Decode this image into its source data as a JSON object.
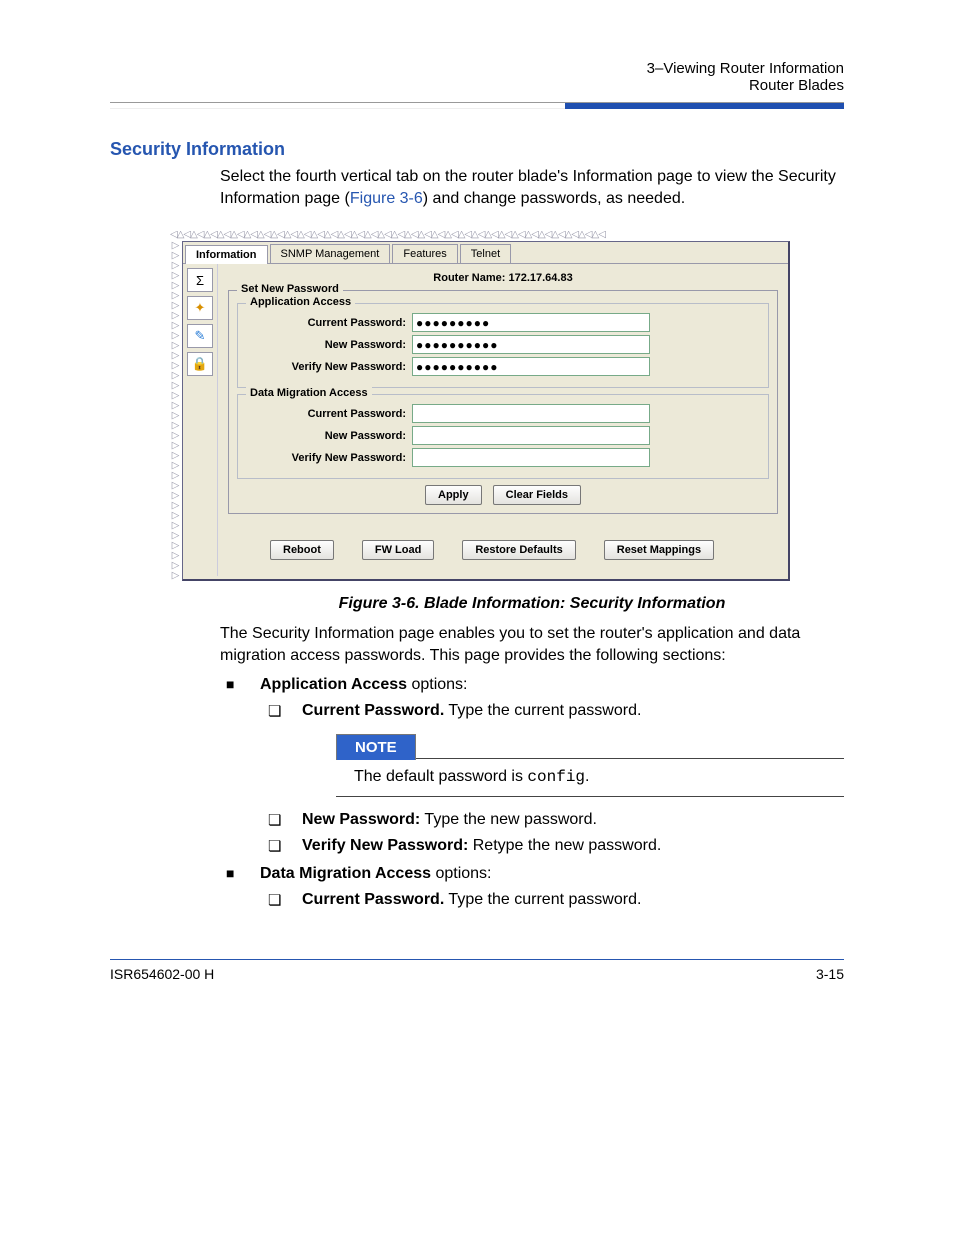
{
  "header": {
    "line1": "3–Viewing Router Information",
    "line2": "Router Blades"
  },
  "section_title": "Security Information",
  "intro_before_link": "Select the fourth vertical tab on the router blade's Information page to view the Security Information page (",
  "intro_link": "Figure 3-6",
  "intro_after_link": ") and change passwords, as needed.",
  "screenshot": {
    "tabs": [
      "Information",
      "SNMP Management",
      "Features",
      "Telnet"
    ],
    "active_tab_index": 0,
    "side_icons": [
      "Σ",
      "✦",
      "✎",
      "🔒"
    ],
    "router_label": "Router Name:",
    "router_name": "172.17.64.83",
    "set_new_password": "Set New Password",
    "app_access": {
      "legend": "Application Access",
      "current_label": "Current Password:",
      "current_value": "●●●●●●●●●",
      "new_label": "New Password:",
      "new_value": "●●●●●●●●●●",
      "verify_label": "Verify New Password:",
      "verify_value": "●●●●●●●●●●"
    },
    "dm_access": {
      "legend": "Data Migration Access",
      "current_label": "Current Password:",
      "current_value": "",
      "new_label": "New Password:",
      "new_value": "",
      "verify_label": "Verify New Password:",
      "verify_value": ""
    },
    "apply": "Apply",
    "clear": "Clear Fields",
    "reboot": "Reboot",
    "fwload": "FW Load",
    "restore": "Restore Defaults",
    "reset": "Reset Mappings"
  },
  "figure_caption": "Figure 3-6. Blade Information: Security Information",
  "para2": "The Security Information page enables you to set the router's application and data migration access passwords. This page provides the following sections:",
  "bullets": {
    "app": {
      "lead_bold": "Application Access",
      "lead_rest": " options:",
      "items": [
        {
          "bold": "Current Password.",
          "rest": " Type the current password."
        },
        {
          "bold": "New Password:",
          "rest": " Type the new password."
        },
        {
          "bold": "Verify New Password:",
          "rest": " Retype the new password."
        }
      ]
    },
    "dm": {
      "lead_bold": "Data Migration Access",
      "lead_rest": " options:",
      "items": [
        {
          "bold": "Current Password.",
          "rest": " Type the current password."
        }
      ]
    }
  },
  "note": {
    "label": "NOTE",
    "text_before": "The default password is ",
    "code": "config",
    "text_after": "."
  },
  "footer": {
    "left": "ISR654602-00  H",
    "right": "3-15"
  }
}
